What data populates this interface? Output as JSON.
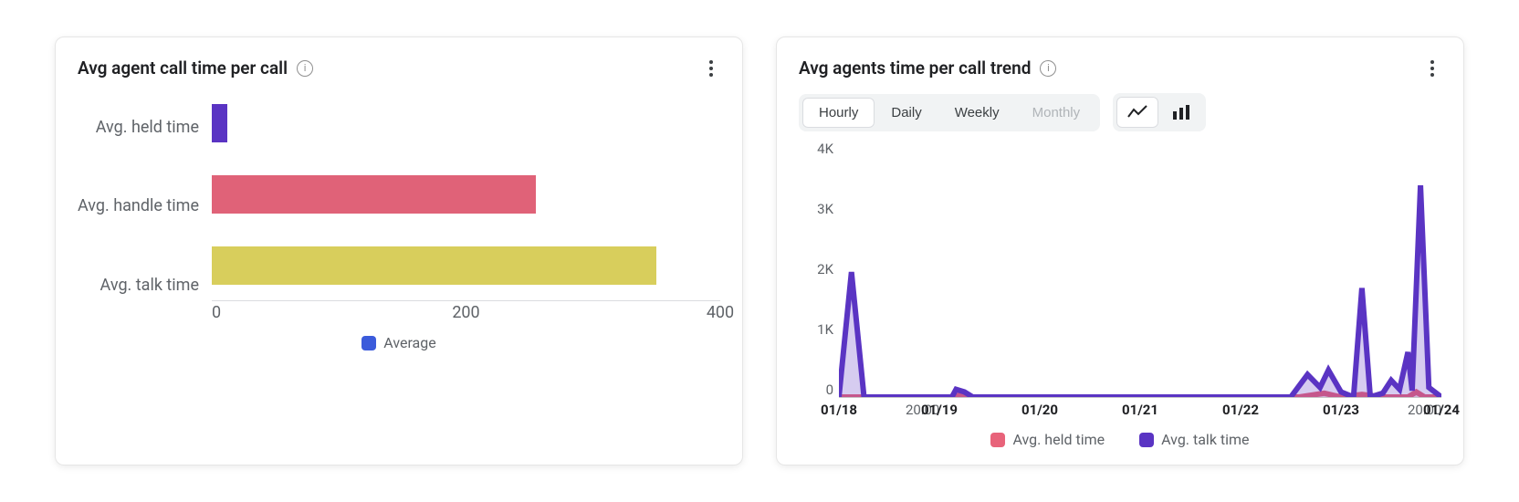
{
  "left": {
    "title": "Avg agent call time per call",
    "legend": "Average",
    "legend_color": "#3b5bdb"
  },
  "right": {
    "title": "Avg agents time per call trend",
    "tabs": {
      "hourly": "Hourly",
      "daily": "Daily",
      "weekly": "Weekly",
      "monthly": "Monthly"
    },
    "legend": {
      "held": "Avg. held time",
      "talk": "Avg. talk time"
    },
    "colors": {
      "held": "#e8637a",
      "talk": "#5a34c3"
    }
  },
  "chart_data": [
    {
      "id": "avg_agent_call_time",
      "type": "bar",
      "orientation": "horizontal",
      "categories": [
        "Avg. held time",
        "Avg. handle time",
        "Avg. talk time"
      ],
      "values": [
        12,
        255,
        350
      ],
      "colors": [
        "#5a34c3",
        "#e06278",
        "#d8ce5c"
      ],
      "xlabel": "",
      "ylabel": "",
      "xlim": [
        0,
        400
      ],
      "xticks": [
        0,
        200,
        400
      ],
      "legend": "Average"
    },
    {
      "id": "avg_agents_time_trend",
      "type": "line",
      "x_axis": {
        "type": "time_hours_since_start",
        "start_label": "01/18 00:00",
        "ticks": [
          {
            "h": 0,
            "label": "01/18",
            "bold": true
          },
          {
            "h": 20,
            "label": "20:00",
            "bold": false
          },
          {
            "h": 24,
            "label": "01/19",
            "bold": true
          },
          {
            "h": 48,
            "label": "01/20",
            "bold": true
          },
          {
            "h": 72,
            "label": "01/21",
            "bold": true
          },
          {
            "h": 96,
            "label": "01/22",
            "bold": true
          },
          {
            "h": 120,
            "label": "01/23",
            "bold": true
          },
          {
            "h": 140,
            "label": "20:00",
            "bold": false
          },
          {
            "h": 144,
            "label": "01/24",
            "bold": true
          }
        ],
        "range": [
          0,
          144
        ]
      },
      "ylim": [
        0,
        4000
      ],
      "yticks": [
        0,
        1000,
        2000,
        3000,
        4000
      ],
      "ytick_labels": [
        "0",
        "1K",
        "2K",
        "3K",
        "4K"
      ],
      "series": [
        {
          "name": "Avg. held time",
          "color": "#e8637a",
          "points": [
            {
              "h": 0,
              "v": 0
            },
            {
              "h": 4,
              "v": 0
            },
            {
              "h": 20,
              "v": 0
            },
            {
              "h": 28,
              "v": 0
            },
            {
              "h": 29,
              "v": 40
            },
            {
              "h": 30,
              "v": 0
            },
            {
              "h": 50,
              "v": 0
            },
            {
              "h": 80,
              "v": 0
            },
            {
              "h": 110,
              "v": 0
            },
            {
              "h": 116,
              "v": 60
            },
            {
              "h": 120,
              "v": 0
            },
            {
              "h": 125,
              "v": 40
            },
            {
              "h": 130,
              "v": 0
            },
            {
              "h": 136,
              "v": 0
            },
            {
              "h": 138,
              "v": 80
            },
            {
              "h": 140,
              "v": 0
            },
            {
              "h": 144,
              "v": 0
            }
          ]
        },
        {
          "name": "Avg. talk time",
          "color": "#5a34c3",
          "points": [
            {
              "h": 0,
              "v": 0
            },
            {
              "h": 3,
              "v": 1950
            },
            {
              "h": 6,
              "v": 0
            },
            {
              "h": 20,
              "v": 0
            },
            {
              "h": 27,
              "v": 0
            },
            {
              "h": 28,
              "v": 120
            },
            {
              "h": 30,
              "v": 80
            },
            {
              "h": 32,
              "v": 0
            },
            {
              "h": 50,
              "v": 0
            },
            {
              "h": 80,
              "v": 0
            },
            {
              "h": 108,
              "v": 0
            },
            {
              "h": 112,
              "v": 350
            },
            {
              "h": 115,
              "v": 150
            },
            {
              "h": 117,
              "v": 420
            },
            {
              "h": 120,
              "v": 80
            },
            {
              "h": 123,
              "v": 0
            },
            {
              "h": 125,
              "v": 1700
            },
            {
              "h": 127,
              "v": 0
            },
            {
              "h": 130,
              "v": 60
            },
            {
              "h": 132,
              "v": 260
            },
            {
              "h": 134,
              "v": 120
            },
            {
              "h": 136,
              "v": 700
            },
            {
              "h": 137,
              "v": 100
            },
            {
              "h": 139,
              "v": 3300
            },
            {
              "h": 141,
              "v": 150
            },
            {
              "h": 144,
              "v": 0
            }
          ]
        }
      ]
    }
  ]
}
